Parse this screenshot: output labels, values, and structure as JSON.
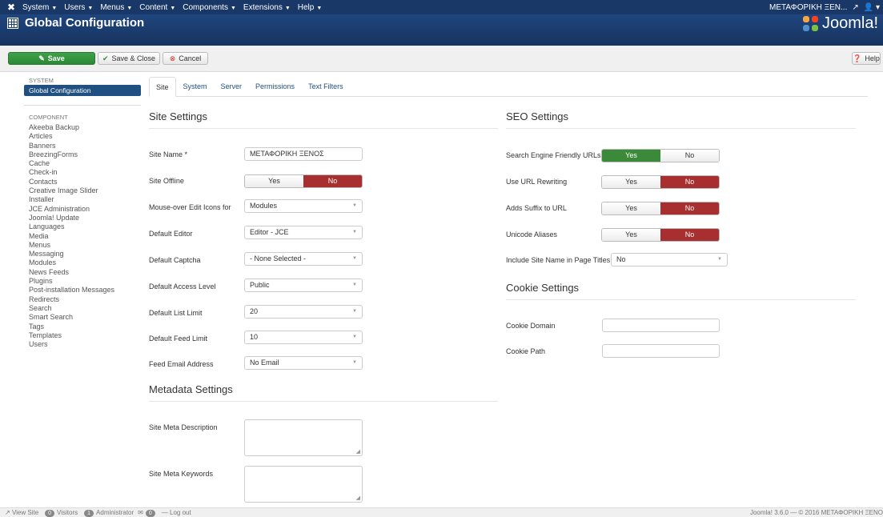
{
  "navbar": {
    "menu": [
      "System",
      "Users",
      "Menus",
      "Content",
      "Components",
      "Extensions",
      "Help"
    ],
    "site_name": "ΜΕΤΑΦΟΡΙΚΗ ΞΕΝ..."
  },
  "header": {
    "title": "Global Configuration",
    "brand": "Joomla!"
  },
  "toolbar": {
    "save": "Save",
    "save_close": "Save & Close",
    "cancel": "Cancel",
    "help": "Help"
  },
  "sidebar": {
    "system_label": "SYSTEM",
    "active_item": "Global Configuration",
    "component_label": "COMPONENT",
    "items": [
      "Akeeba Backup",
      "Articles",
      "Banners",
      "BreezingForms",
      "Cache",
      "Check-in",
      "Contacts",
      "Creative Image Slider",
      "Installer",
      "JCE Administration",
      "Joomla! Update",
      "Languages",
      "Media",
      "Menus",
      "Messaging",
      "Modules",
      "News Feeds",
      "Plugins",
      "Post-installation Messages",
      "Redirects",
      "Search",
      "Smart Search",
      "Tags",
      "Templates",
      "Users"
    ]
  },
  "tabs": [
    "Site",
    "System",
    "Server",
    "Permissions",
    "Text Filters"
  ],
  "site_settings": {
    "title": "Site Settings",
    "site_name_label": "Site Name *",
    "site_name_value": "ΜΕΤΑΦΟΡΙΚΗ ΞΕΝΟΣ",
    "site_offline_label": "Site Offline",
    "yes": "Yes",
    "no": "No",
    "mouseover_label": "Mouse-over Edit Icons for",
    "mouseover_value": "Modules",
    "editor_label": "Default Editor",
    "editor_value": "Editor - JCE",
    "captcha_label": "Default Captcha",
    "captcha_value": "- None Selected -",
    "access_label": "Default Access Level",
    "access_value": "Public",
    "list_limit_label": "Default List Limit",
    "list_limit_value": "20",
    "feed_limit_label": "Default Feed Limit",
    "feed_limit_value": "10",
    "feed_email_label": "Feed Email Address",
    "feed_email_value": "No Email"
  },
  "metadata_settings": {
    "title": "Metadata Settings",
    "description_label": "Site Meta Description",
    "keywords_label": "Site Meta Keywords"
  },
  "seo_settings": {
    "title": "SEO Settings",
    "sef_label": "Search Engine Friendly URLs",
    "rewrite_label": "Use URL Rewriting",
    "suffix_label": "Adds Suffix to URL",
    "unicode_label": "Unicode Aliases",
    "sitename_titles_label": "Include Site Name in Page Titles",
    "sitename_titles_value": "No"
  },
  "cookie_settings": {
    "title": "Cookie Settings",
    "domain_label": "Cookie Domain",
    "path_label": "Cookie Path"
  },
  "footer": {
    "view_site": "View Site",
    "visitors_count": "0",
    "visitors": "Visitors",
    "admins_count": "1",
    "administrator": "Administrator",
    "messages_count": "0",
    "logout": "Log out",
    "version": "Joomla! 3.6.0 — © 2016 ΜΕΤΑΦΟΡΙΚΗ ΞΕΝΟ"
  },
  "colors": {
    "navbar": "#1a3867",
    "save_green": "#2c8935",
    "toggle_yes": "#3a8a3a",
    "toggle_no": "#a72f2f"
  }
}
